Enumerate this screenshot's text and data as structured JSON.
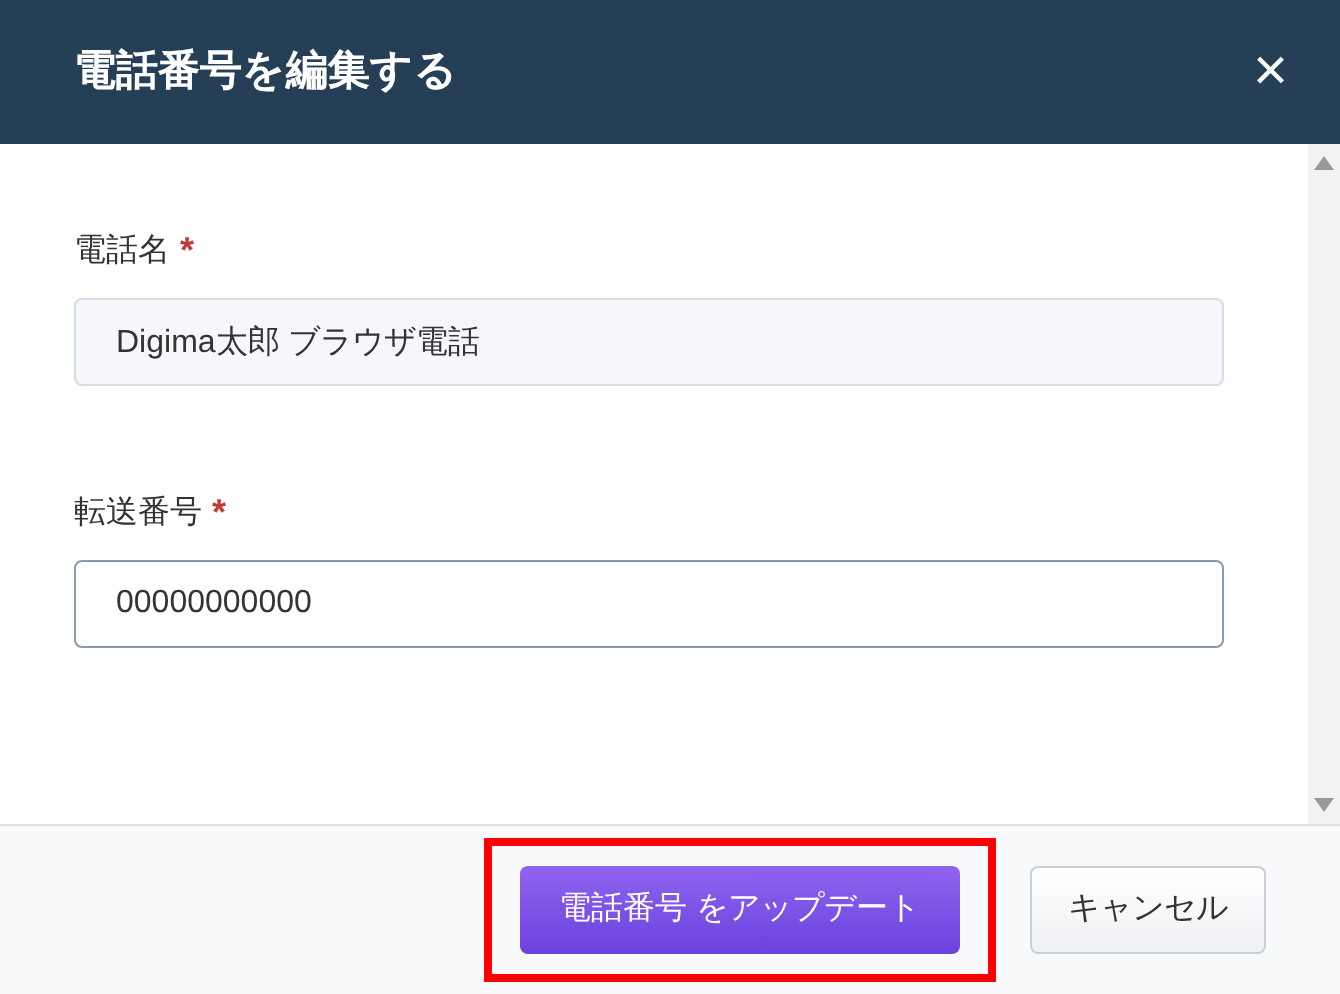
{
  "dialog": {
    "title": "電話番号を編集する",
    "close": "×"
  },
  "fields": [
    {
      "label": "電話名",
      "required_mark": "*",
      "value": "Digima太郎 ブラウザ電話",
      "disabled": true
    },
    {
      "label": "転送番号",
      "required_mark": "*",
      "value": "00000000000",
      "disabled": false
    }
  ],
  "buttons": [
    {
      "label": "電話番号 をアップデート",
      "kind": "primary",
      "highlighted": true
    },
    {
      "label": "キャンセル",
      "kind": "secondary",
      "highlighted": false
    }
  ]
}
